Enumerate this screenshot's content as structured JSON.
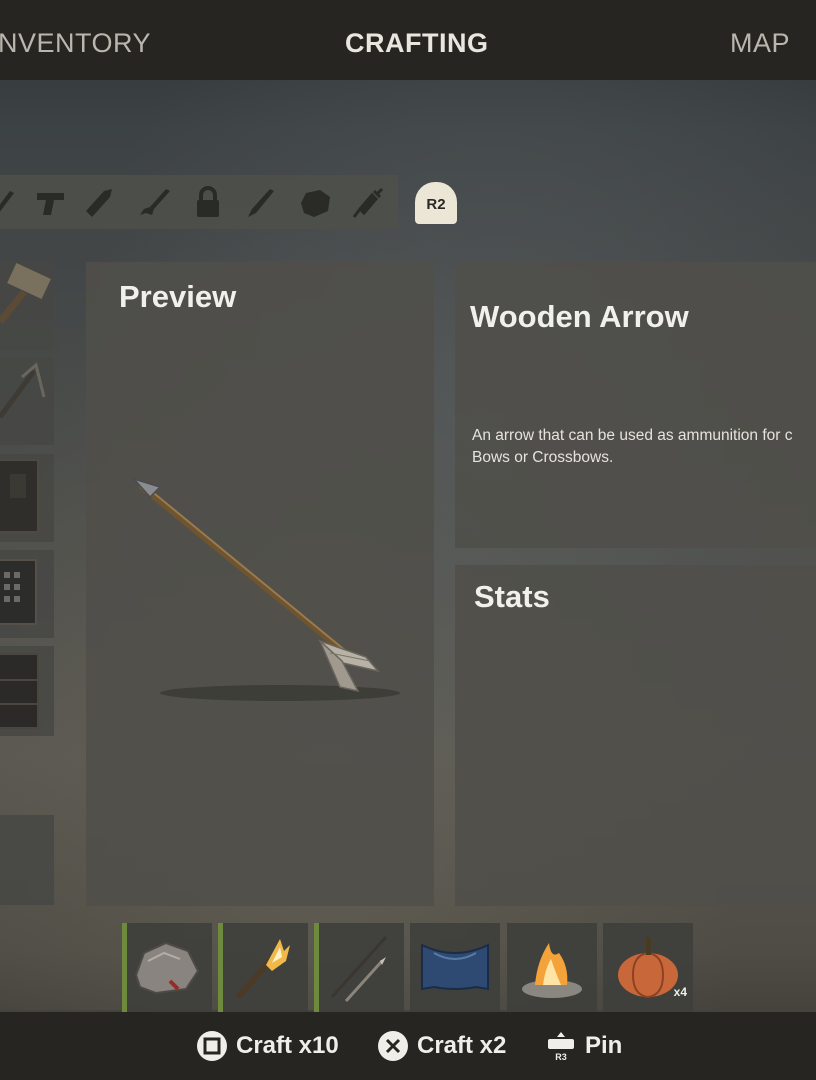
{
  "top_nav": {
    "tabs": [
      {
        "label": "NVENTORY",
        "active": false
      },
      {
        "label": "CRAFTING",
        "active": true
      },
      {
        "label": "MAP",
        "active": false
      }
    ]
  },
  "category_bar": {
    "icons": [
      "weapon-icon",
      "pistol-icon",
      "ammo-icon",
      "rifle-icon",
      "lock-icon",
      "tool-icon",
      "resource-icon",
      "syringe-icon"
    ],
    "next_category_button": "R2"
  },
  "preview_panel": {
    "title": "Preview",
    "item_icon": "wooden-arrow-icon"
  },
  "item_info": {
    "name": "Wooden Arrow",
    "description_line1": "An arrow that can be used as ammunition for c",
    "description_line2": "Bows or Crossbows."
  },
  "stats_panel": {
    "title": "Stats"
  },
  "hotbar": {
    "slots": [
      {
        "icon": "stone-icon",
        "marked": true,
        "quantity": ""
      },
      {
        "icon": "torch-icon",
        "marked": true,
        "quantity": ""
      },
      {
        "icon": "arrow-icon",
        "marked": true,
        "quantity": ""
      },
      {
        "icon": "metal-sheet-icon",
        "marked": false,
        "quantity": ""
      },
      {
        "icon": "campfire-icon",
        "marked": false,
        "quantity": ""
      },
      {
        "icon": "pumpkin-icon",
        "marked": false,
        "quantity": "x4"
      }
    ]
  },
  "actions": {
    "craft_x10": "Craft x10",
    "craft_x2": "Craft x2",
    "pin": "Pin",
    "pin_button_glyph": "R3"
  },
  "colors": {
    "accent_green": "#6e8a3c",
    "bar_dark": "#262522",
    "r2_badge": "#ece6d6"
  }
}
